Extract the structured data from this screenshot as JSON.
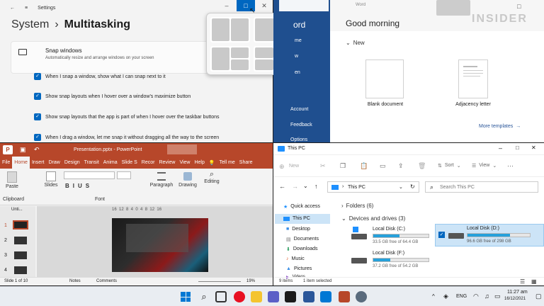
{
  "settings": {
    "app_name": "Settings",
    "breadcrumb_parent": "System",
    "breadcrumb_sep": "›",
    "page_title": "Multitasking",
    "snap_title": "Snap windows",
    "snap_desc": "Automatically resize and arrange windows on your screen",
    "options": [
      "When I snap a window, show what I can snap next to it",
      "Show snap layouts when I hover over a window's maximize button",
      "Show snap layouts that the app is part of when I hover over the taskbar buttons",
      "When I drag a window, let me snap it without dragging all the way to the screen"
    ]
  },
  "word": {
    "title_fragment": "Word",
    "app_fragment": "ord",
    "watermark": "INSIDER",
    "side_items": [
      "me",
      "w",
      "en",
      "Account",
      "Feedback",
      "Options"
    ],
    "greeting": "Good morning",
    "new_label": "New",
    "templates": [
      "Blank document",
      "Adjacency letter"
    ],
    "more_templates": "More templates",
    "colors": {
      "side": "#1f4f8f",
      "accent": "#2b579a"
    }
  },
  "powerpoint": {
    "title": "Presentation.pptx - PowerPoint",
    "tabs": [
      "File",
      "Home",
      "Insert",
      "Draw",
      "Design",
      "Transit",
      "Anima",
      "Slide S",
      "Recor",
      "Review",
      "View",
      "Help"
    ],
    "tell_me": "Tell me",
    "share": "Share",
    "groups": [
      "Paste",
      "Clipboard",
      "Slides",
      "Font",
      "Paragraph",
      "Drawing",
      "Editing"
    ],
    "font_size_hint": "",
    "ruler": "16  12  8  4  0  4  8  12  16",
    "thumb_header": "Unti...",
    "thumb_numbers": [
      "1",
      "2",
      "3",
      "4"
    ],
    "status_slide": "Slide 1 of 10",
    "notes": "Notes",
    "comments": "Comments",
    "zoom": "19%",
    "colors": {
      "brand": "#b7472a"
    }
  },
  "explorer": {
    "title": "This PC",
    "new_label": "New",
    "sort_label": "Sort",
    "view_label": "View",
    "address": "This PC",
    "search_placeholder": "Search This PC",
    "nav_items": [
      "Quick access",
      "This PC",
      "Desktop",
      "Documents",
      "Downloads",
      "Music",
      "Pictures",
      "Videos"
    ],
    "folders_header": "Folders (6)",
    "drives_header": "Devices and drives (3)",
    "drives": [
      {
        "name": "Local Disk (C:)",
        "free": "33.5 GB free of 64.4 GB",
        "used": 0.48
      },
      {
        "name": "Local Disk (D:)",
        "free": "96.6 GB free of 298 GB",
        "used": 0.68
      },
      {
        "name": "Local Disk (F:)",
        "free": "37.2 GB free of 54.2 GB",
        "used": 0.31
      }
    ],
    "status_items": "9 items",
    "status_selected": "1 item selected"
  },
  "taskbar": {
    "lang": "ENG",
    "time": "11:27 am",
    "date": "16/12/2021",
    "tray_arrow": "^"
  }
}
